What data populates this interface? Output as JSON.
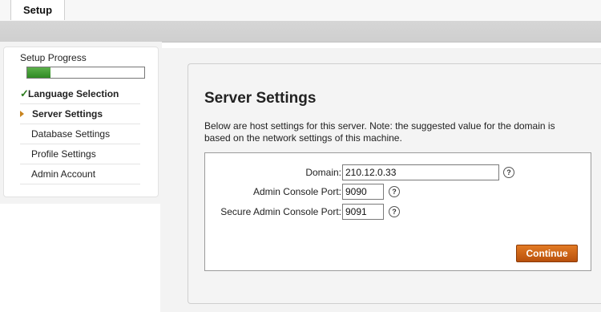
{
  "header": {
    "tab_label": "Setup"
  },
  "sidebar": {
    "progress_label": "Setup Progress",
    "progress": 0.2,
    "items": [
      {
        "label": "Language Selection",
        "state": "done"
      },
      {
        "label": "Server Settings",
        "state": "active"
      },
      {
        "label": "Database Settings",
        "state": "pending"
      },
      {
        "label": "Profile Settings",
        "state": "pending"
      },
      {
        "label": "Admin Account",
        "state": "pending"
      }
    ]
  },
  "main": {
    "title": "Server Settings",
    "description": "Below are host settings for this server. Note: the suggested value for the domain is based on the network settings of this machine.",
    "fields": {
      "domain": {
        "label": "Domain:",
        "value": "210.12.0.33"
      },
      "admin_port": {
        "label": "Admin Console Port:",
        "value": "9090"
      },
      "secure_port": {
        "label": "Secure Admin Console Port:",
        "value": "9091"
      }
    },
    "help_glyph": "?",
    "continue_label": "Continue"
  },
  "colors": {
    "accent": "#c8841e",
    "progress": "#3a9a2a",
    "button": "#c9600f",
    "check": "#2e7d1f"
  }
}
